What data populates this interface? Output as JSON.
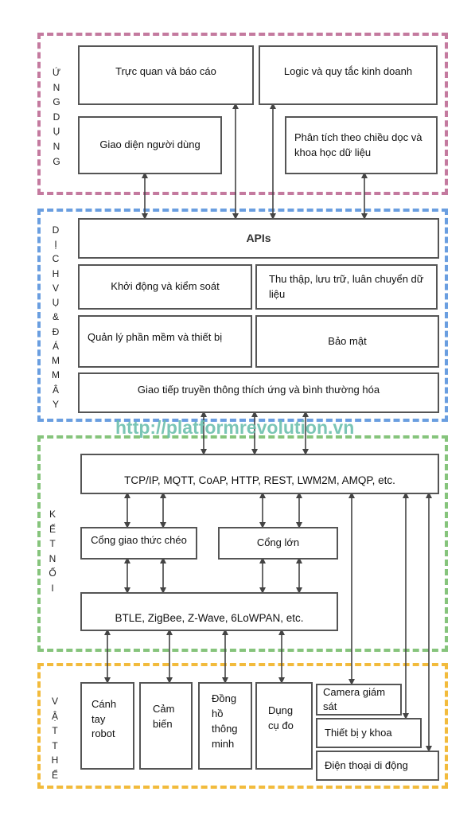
{
  "layers": {
    "application": {
      "label": "ỨNG DỤNG",
      "color": "#c47a9f"
    },
    "cloud": {
      "label": "DỊCH VỤ & ĐÁM MÂY",
      "color": "#6a9ee0"
    },
    "connectivity": {
      "label": "KẾT NỐI",
      "color": "#86c47c"
    },
    "things": {
      "label": "VẬT THỂ",
      "color": "#f2bb3c"
    }
  },
  "application": {
    "visualization": "Trực quan và báo cáo",
    "business_logic": "Logic và quy tắc kinh doanh",
    "user_interface": "Giao diện người dùng",
    "analytics": "Phân tích theo chiều dọc và khoa học dữ liệu"
  },
  "cloud": {
    "apis": "APIs",
    "provisioning": "Khởi động và kiểm soát",
    "data_collection": "Thu thập, lưu trữ, luân chuyển dữ liệu",
    "device_management": "Quản lý phần mềm và thiết bị",
    "security": "Bảo mật",
    "communication": "Giao tiếp truyền thông thích ứng và bình thường hóa"
  },
  "watermark": "http://platformrevolution.vn",
  "connectivity": {
    "internet_protocols": "TCP/IP, MQTT, CoAP, HTTP, REST, LWM2M, AMQP, etc.",
    "cross_protocol_gateway": "Cổng giao thức chéo",
    "large_gateway": "Cổng lớn",
    "local_protocols": "BTLE, ZigBee, Z-Wave, 6LoWPAN, etc."
  },
  "things": {
    "robot_arm": "Cánh tay robot",
    "sensor": "Cảm biến",
    "smart_watch": "Đồng hồ thông minh",
    "measuring_tool": "Dụng cụ đo",
    "camera": "Camera giám sát",
    "medical_device": "Thiết bị y khoa",
    "mobile_phone": "Điện thoại di động"
  }
}
